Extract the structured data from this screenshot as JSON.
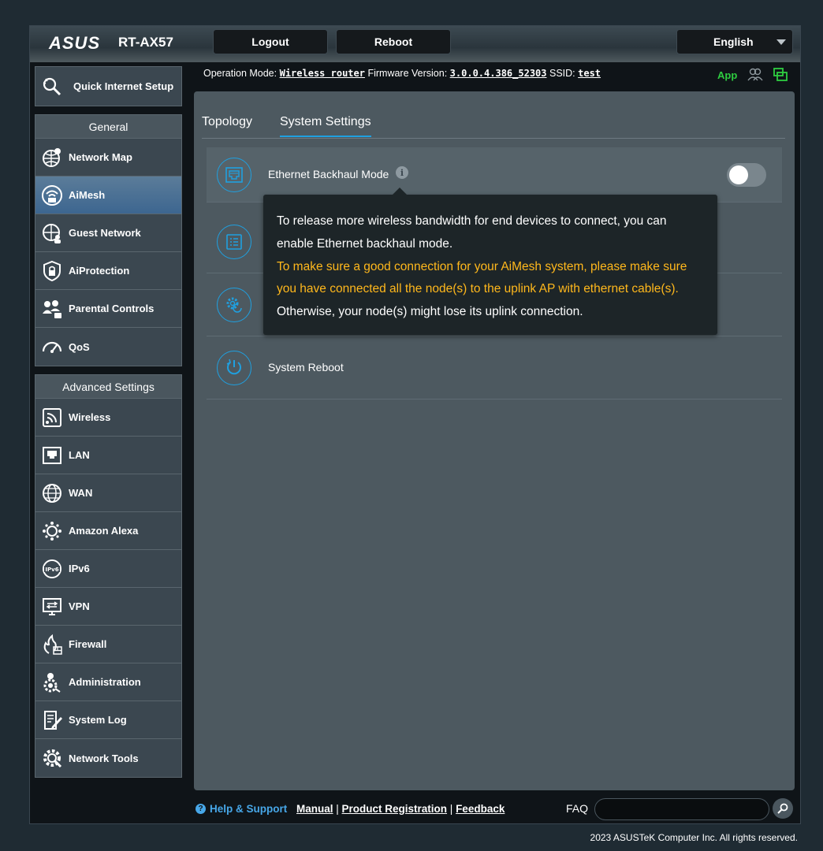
{
  "header": {
    "logo": "ASUS",
    "model": "RT-AX57",
    "logout_label": "Logout",
    "reboot_label": "Reboot",
    "language": "English"
  },
  "status": {
    "op_mode_label": "Operation Mode:",
    "op_mode_value": "Wireless router",
    "fw_label": "Firmware Version:",
    "fw_value": "3.0.0.4.386_52303",
    "ssid_label": "SSID:",
    "ssid_value": "test",
    "app_label": "App"
  },
  "sidebar": {
    "quick_setup": "Quick Internet Setup",
    "general_title": "General",
    "general_items": [
      {
        "label": "Network Map",
        "icon": "network-map-icon"
      },
      {
        "label": "AiMesh",
        "icon": "aimesh-icon"
      },
      {
        "label": "Guest Network",
        "icon": "guest-network-icon"
      },
      {
        "label": "AiProtection",
        "icon": "aiprotection-icon"
      },
      {
        "label": "Parental Controls",
        "icon": "parental-controls-icon"
      },
      {
        "label": "QoS",
        "icon": "qos-icon"
      }
    ],
    "advanced_title": "Advanced Settings",
    "advanced_items": [
      {
        "label": "Wireless",
        "icon": "wireless-icon"
      },
      {
        "label": "LAN",
        "icon": "lan-icon"
      },
      {
        "label": "WAN",
        "icon": "wan-icon"
      },
      {
        "label": "Amazon Alexa",
        "icon": "alexa-icon"
      },
      {
        "label": "IPv6",
        "icon": "ipv6-icon"
      },
      {
        "label": "VPN",
        "icon": "vpn-icon"
      },
      {
        "label": "Firewall",
        "icon": "firewall-icon"
      },
      {
        "label": "Administration",
        "icon": "administration-icon"
      },
      {
        "label": "System Log",
        "icon": "system-log-icon"
      },
      {
        "label": "Network Tools",
        "icon": "network-tools-icon"
      }
    ]
  },
  "main": {
    "tabs": [
      {
        "label": "Topology",
        "active": false
      },
      {
        "label": "System Settings",
        "active": true
      }
    ],
    "settings": [
      {
        "label": "Ethernet Backhaul Mode",
        "toggle": false
      },
      {
        "label": "System Reboot"
      }
    ],
    "tooltip": {
      "line1": "To release more wireless bandwidth for end devices to connect, you can enable Ethernet backhaul mode.",
      "warning": "To make sure a good connection for your AiMesh system, please make sure you have connected all the node(s) to the uplink AP with ethernet cable(s).",
      "line3": "Otherwise, your node(s) might lose its uplink connection."
    }
  },
  "footer": {
    "help": "Help & Support",
    "manual": "Manual",
    "registration": "Product Registration",
    "feedback": "Feedback",
    "faq": "FAQ",
    "copyright": "2023 ASUSTeK Computer Inc. All rights reserved."
  },
  "colors": {
    "accent": "#1fa0e0",
    "warning": "#ffb81c",
    "app_green": "#2ecc40"
  }
}
